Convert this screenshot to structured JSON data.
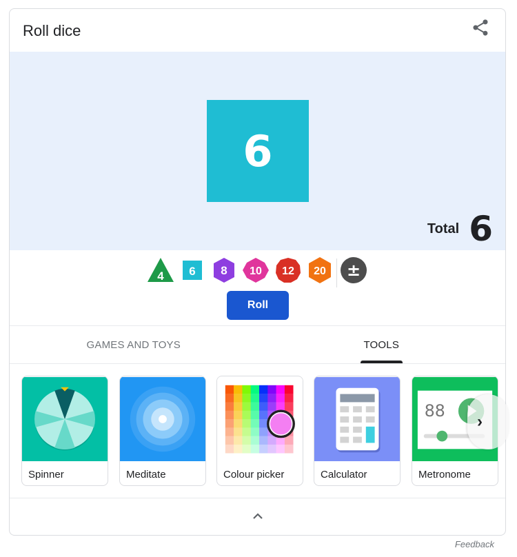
{
  "header": {
    "title": "Roll dice",
    "share_icon": "share-icon"
  },
  "dice_area": {
    "result_die": {
      "type": "d6",
      "value": "6",
      "color": "#1fbdd3"
    },
    "total_label": "Total",
    "total_value": "6"
  },
  "dice_options": [
    {
      "name": "d4",
      "label": "4",
      "color": "#1e9a48",
      "shape": "triangle"
    },
    {
      "name": "d6",
      "label": "6",
      "color": "#1fbdd3",
      "shape": "square"
    },
    {
      "name": "d8",
      "label": "8",
      "color": "#8e3ee0",
      "shape": "hexagon"
    },
    {
      "name": "d10",
      "label": "10",
      "color": "#e0359c",
      "shape": "diamond"
    },
    {
      "name": "d12",
      "label": "12",
      "color": "#d93025",
      "shape": "decagon"
    },
    {
      "name": "d20",
      "label": "20",
      "color": "#f17312",
      "shape": "hexagon"
    }
  ],
  "modifier": {
    "label": "±",
    "color": "#4d4d4d"
  },
  "roll_button": {
    "label": "Roll",
    "color": "#1a57d0"
  },
  "tabs": [
    {
      "label": "GAMES AND TOYS",
      "selected": false
    },
    {
      "label": "TOOLS",
      "selected": true
    }
  ],
  "tiles": [
    {
      "label": "Spinner",
      "bg": "#03bfa5"
    },
    {
      "label": "Meditate",
      "bg": "#2196f3"
    },
    {
      "label": "Colour picker",
      "bg": "#ffffff"
    },
    {
      "label": "Calculator",
      "bg": "#7b8ff7"
    },
    {
      "label": "Metronome",
      "bg": "#0ebe5c",
      "bpm": "88"
    }
  ],
  "next_icon": "chevron-right-icon",
  "collapse_icon": "chevron-up-icon",
  "feedback": "Feedback"
}
